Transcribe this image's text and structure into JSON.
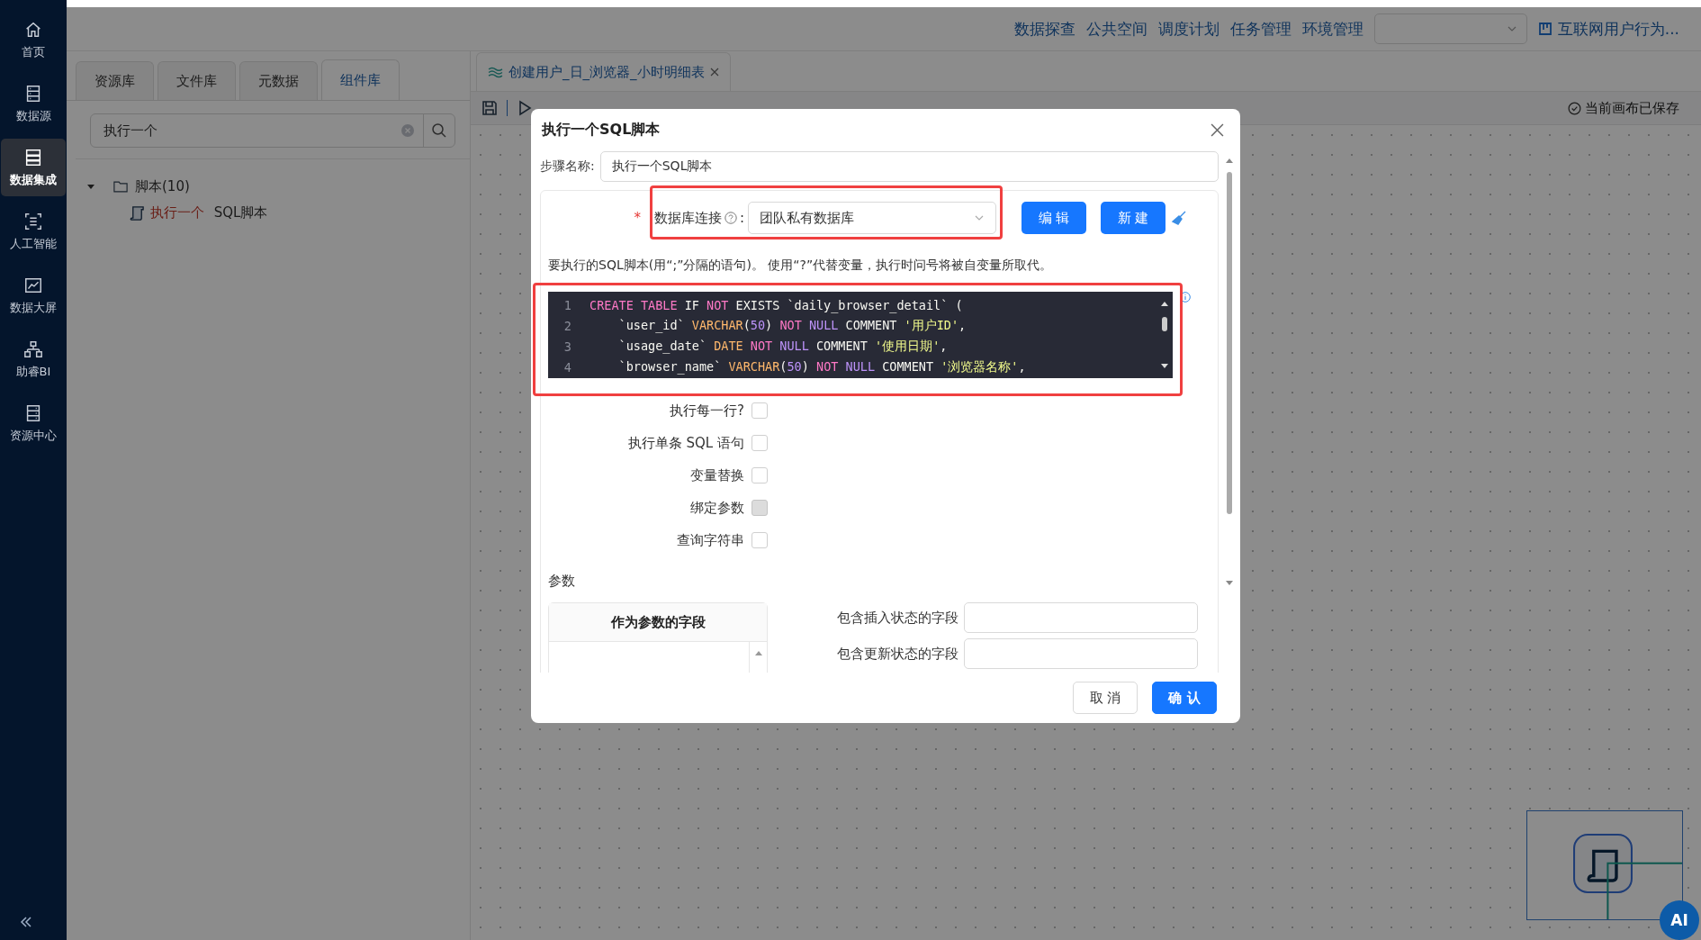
{
  "sidebar": {
    "items": [
      {
        "label": "首页",
        "selected": false
      },
      {
        "label": "数据源",
        "selected": false
      },
      {
        "label": "数据集成",
        "selected": true
      },
      {
        "label": "人工智能",
        "selected": false
      },
      {
        "label": "数据大屏",
        "selected": false
      },
      {
        "label": "助睿BI",
        "selected": false
      },
      {
        "label": "资源中心",
        "selected": false
      }
    ]
  },
  "header": {
    "nav": [
      "数据探查",
      "公共空间",
      "调度计划",
      "任务管理",
      "环境管理"
    ],
    "project": "互联网用户行为..."
  },
  "left_panel": {
    "tabs": [
      {
        "label": "资源库",
        "selected": false
      },
      {
        "label": "文件库",
        "selected": false
      },
      {
        "label": "元数据",
        "selected": false
      },
      {
        "label": "组件库",
        "selected": true
      }
    ],
    "search": {
      "value": "执行一个"
    },
    "tree": [
      {
        "label": "脚本(10)",
        "expanded": true,
        "children": [
          {
            "match": "执行一个",
            "rest": " SQL脚本"
          }
        ]
      }
    ]
  },
  "editor": {
    "tabs": [
      {
        "label": "创建用户_日_浏览器_小时明细表",
        "selected": true
      }
    ],
    "status": "当前画布已保存"
  },
  "dialog": {
    "title": "执行一个SQL脚本",
    "step_name": {
      "label": "步骤名称:",
      "value": "执行一个SQL脚本"
    },
    "connection": {
      "required_mark": "*",
      "label": "数据库连接",
      "label_suffix": ":",
      "value": "团队私有数据库"
    },
    "connection_buttons": [
      "编 辑",
      "新 建"
    ],
    "script_hint": "要执行的SQL脚本(用“;”分隔的语句)。 使用“?”代替变量，执行时问号将被自变量所取代。",
    "code_lines": [
      {
        "number": "1",
        "tokens": [
          {
            "t": "CREATE TABLE",
            "kind": "kw"
          },
          {
            "t": " IF ",
            "kind": "plain"
          },
          {
            "t": "NOT",
            "kind": "kw"
          },
          {
            "t": " EXISTS `daily_browser_detail` (",
            "kind": "plain"
          }
        ]
      },
      {
        "number": "2",
        "tokens": [
          {
            "t": "    `user_id` ",
            "kind": "plain"
          },
          {
            "t": "VARCHAR",
            "kind": "type"
          },
          {
            "t": "(",
            "kind": "plain"
          },
          {
            "t": "50",
            "kind": "num"
          },
          {
            "t": ") ",
            "kind": "plain"
          },
          {
            "t": "NOT",
            "kind": "kw"
          },
          {
            "t": " NULL",
            "kind": "num"
          },
          {
            "t": " COMMENT ",
            "kind": "plain"
          },
          {
            "t": "'用户ID'",
            "kind": "str"
          },
          {
            "t": ",",
            "kind": "plain"
          }
        ]
      },
      {
        "number": "3",
        "tokens": [
          {
            "t": "    `usage_date` ",
            "kind": "plain"
          },
          {
            "t": "DATE",
            "kind": "type"
          },
          {
            "t": " NOT",
            "kind": "kw"
          },
          {
            "t": " NULL",
            "kind": "num"
          },
          {
            "t": " COMMENT ",
            "kind": "plain"
          },
          {
            "t": "'使用日期'",
            "kind": "str"
          },
          {
            "t": ",",
            "kind": "plain"
          }
        ]
      },
      {
        "number": "4",
        "tokens": [
          {
            "t": "    `browser_name` ",
            "kind": "plain"
          },
          {
            "t": "VARCHAR",
            "kind": "type"
          },
          {
            "t": "(",
            "kind": "plain"
          },
          {
            "t": "50",
            "kind": "num"
          },
          {
            "t": ") ",
            "kind": "plain"
          },
          {
            "t": "NOT",
            "kind": "kw"
          },
          {
            "t": " NULL",
            "kind": "num"
          },
          {
            "t": " COMMENT ",
            "kind": "plain"
          },
          {
            "t": "'浏览器名称'",
            "kind": "str"
          },
          {
            "t": ",",
            "kind": "plain"
          }
        ]
      }
    ],
    "options": [
      {
        "label": "执行每一行?",
        "checked": false,
        "disabled": false
      },
      {
        "label": "执行单条 SQL 语句",
        "checked": false,
        "disabled": false
      },
      {
        "label": "变量替换",
        "checked": false,
        "disabled": false
      },
      {
        "label": "绑定参数",
        "checked": false,
        "disabled": true
      },
      {
        "label": "查询字符串",
        "checked": false,
        "disabled": false
      }
    ],
    "params_label": "参数",
    "params_table": {
      "columns": [
        "作为参数的字段"
      ]
    },
    "status_fields": [
      {
        "label": "包含插入状态的字段"
      },
      {
        "label": "包含更新状态的字段"
      }
    ],
    "footer_buttons": [
      {
        "label": "取 消",
        "kind": "secondary"
      },
      {
        "label": "确 认",
        "kind": "primary"
      }
    ]
  },
  "assistant": {
    "label": "AI"
  }
}
